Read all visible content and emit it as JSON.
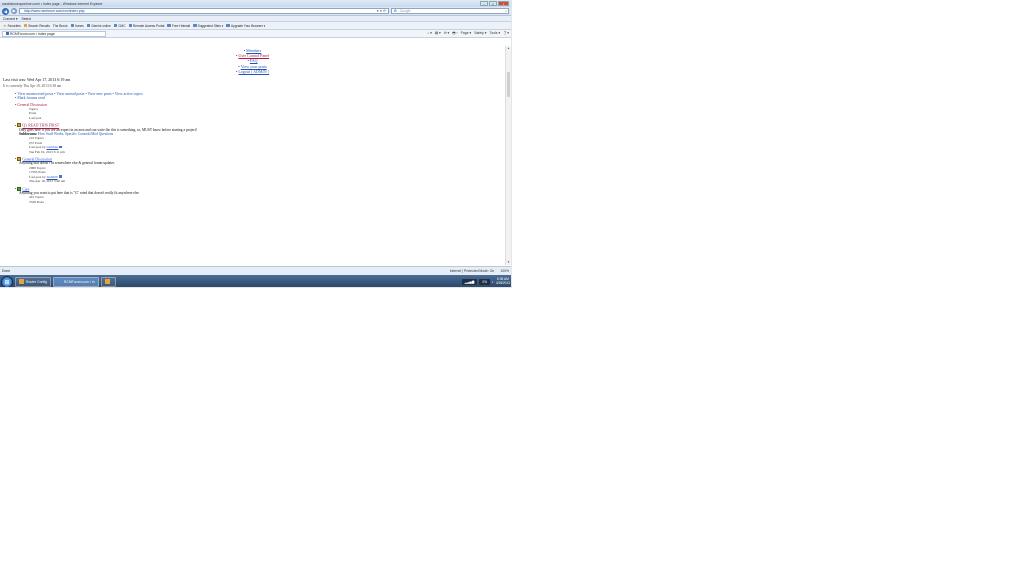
{
  "window": {
    "title": "sarahstoneuponline.com/ • Index page - Windows Internet Explorer",
    "controls": [
      "–",
      "□",
      "×"
    ]
  },
  "address": {
    "url": "http://www.rcmforum.com/rcm/index.php",
    "url_icons": "▾ ✕ ⟳",
    "search_placeholder": "Google",
    "search_brand": "G"
  },
  "menubar": {
    "items": [
      "Convert ▾",
      "Select"
    ]
  },
  "favorites": {
    "items": [
      "Favorites",
      "Search Results",
      "The Brook",
      "Itunes",
      "Gemini online",
      "CMC",
      "Remote Access Portal",
      "Free Hotmail",
      "Suggested Sites ▾",
      "Upgrade Your Browser ▾"
    ],
    "tools": [
      "⌂ ▾",
      "▤ ▾",
      "✉ ▾",
      "🖶 ▾",
      "Page ▾",
      "Safety ▾",
      "Tools ▾",
      "❓▾"
    ]
  },
  "tabs": [
    {
      "label": "RCMForum.com • Index page"
    }
  ],
  "content": {
    "top_links": [
      {
        "label": "Members",
        "color": "blue"
      },
      {
        "label": "User Control Panel",
        "color": "red"
      },
      {
        "label": "FAQ",
        "color": "blue"
      },
      {
        "label": "View your posts",
        "color": "blue"
      },
      {
        "label": "Logout [ ADMIN ]",
        "color": "blue"
      }
    ],
    "last_visit": "Last visit was: Wed Apr 17, 2013 6:19 am",
    "current_time": "It is currently Thu Apr 18, 2013 6:38 am",
    "view_links": "View unanswered posts • View unread posts • View new posts • View active topics",
    "mark_read": "Mark forums read",
    "category": {
      "name": "General Discussion",
      "headers": [
        "Topics",
        "Posts",
        "Last post"
      ]
    },
    "forums": [
      {
        "name": "Q's READ THIS FIRST",
        "description": "Only goes here if you are an expert in an area and can write the this is something, so, MUST know before starting a project!",
        "subforums_label": "Subforums:",
        "subforums": "How Stuff Works, Specific Controls/Mod Questions",
        "topics": "101 Topics",
        "posts": "237 Posts",
        "last_post_by": "Last post by",
        "author": "LinkStar",
        "date": "Tue Feb 19, 2013 3:11 pm"
      },
      {
        "name": "General Discussion",
        "description": "Anything that doesn't fit somewhere else & general forum updates",
        "topics": "2089 Topics",
        "posts": "17565 Posts",
        "last_post_by": "Last post by",
        "author": "Ian4000",
        "date": "Thu Apr 18, 2013 5:26 am"
      },
      {
        "name": "Cars",
        "description": "Anything you want to put here that is \"G\" rated that doesn't really fit anywhere else",
        "topics": "401 Topics",
        "posts": "5528 Posts"
      }
    ]
  },
  "status": {
    "left": "Done",
    "zone": "Internet | Protected Mode: On",
    "zoom": "100%"
  },
  "taskbar": {
    "items": [
      {
        "label": "Router Config",
        "active": false
      },
      {
        "label": "RCMForum.com • In",
        "active": true
      },
      {
        "label": "",
        "active": false
      }
    ],
    "tray_label": "EN",
    "time": "6:38 AM",
    "date": "4/18/2013"
  }
}
